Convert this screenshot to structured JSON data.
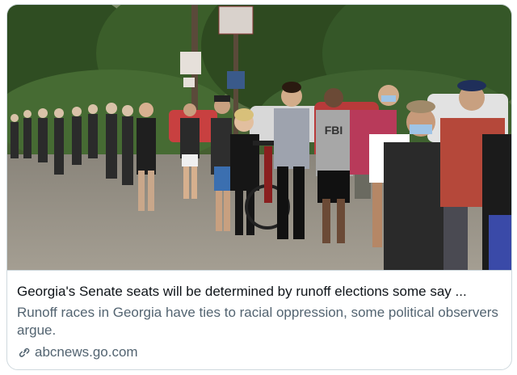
{
  "card": {
    "title": "Georgia's Senate seats will be determined by runoff elections some say ...",
    "description": "Runoff races in Georgia have ties to racial oppression, some political observers argue.",
    "domain": "abcnews.go.com",
    "photo_sign_text": "FBI"
  },
  "colors": {
    "border": "#cfd9de",
    "title": "#0f1419",
    "secondary": "#536471"
  },
  "icons": {
    "link": "link-icon"
  }
}
